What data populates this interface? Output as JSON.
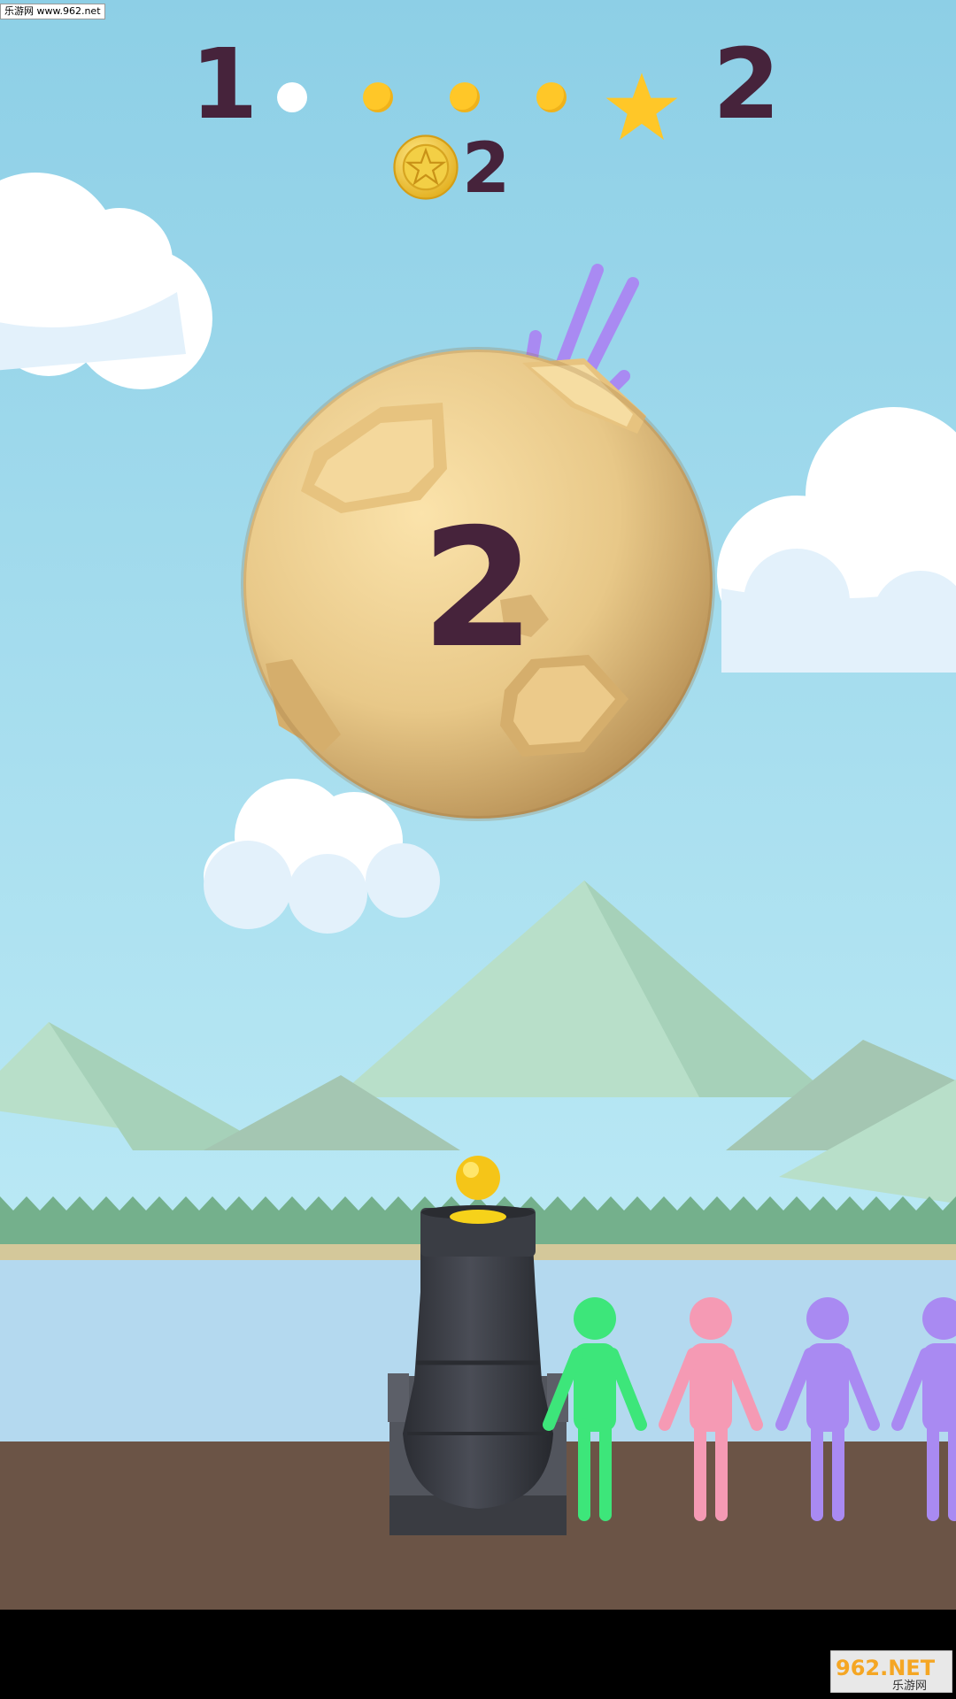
{
  "watermark": {
    "top_text": "乐游网 www.962.net",
    "logo_text": "962.NET",
    "logo_sub": "乐游网"
  },
  "hud": {
    "level_current": "1",
    "level_next": "2",
    "progress_dots": [
      "done",
      "todo",
      "todo",
      "todo"
    ],
    "star_icon": "star-icon",
    "coins": {
      "icon": "coin-icon",
      "count": "2"
    }
  },
  "target": {
    "number": "2"
  },
  "colors": {
    "sky_top": "#8fd0e6",
    "sky_bottom": "#c5eef8",
    "text_dark": "#46233b",
    "accent_yellow": "#ffc728",
    "ground": "#6b5446",
    "water": "#b4d9ef",
    "cannon": "#3d4048"
  },
  "crowd": [
    {
      "color": "#3de67a"
    },
    {
      "color": "#f59ab4"
    },
    {
      "color": "#a98af2"
    },
    {
      "color": "#a98af2"
    }
  ]
}
